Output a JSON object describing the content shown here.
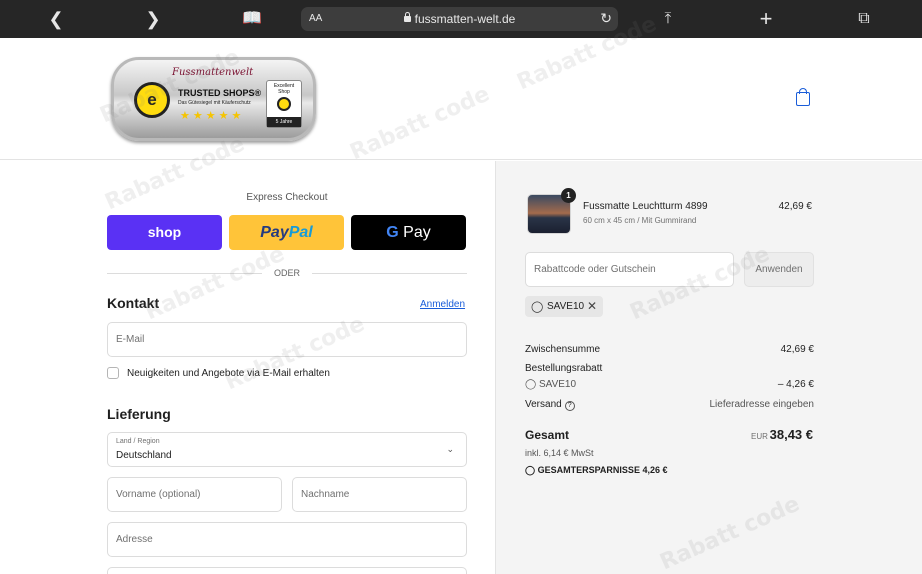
{
  "browser": {
    "text_size_label": "AA",
    "url": "fussmatten-welt.de",
    "icons": [
      "back-icon",
      "forward-icon",
      "bookmarks-icon",
      "lock-icon",
      "reload-icon",
      "share-icon",
      "new-tab-icon",
      "tabs-icon"
    ]
  },
  "header": {
    "logo_brand": "Fussmattenwelt",
    "trust_badge": {
      "title": "TRUSTED SHOPS®",
      "subtitle": "Das Gütesiegel mit Käuferschutz",
      "stars": "★★★★★",
      "box_line1": "Excellent",
      "box_line2": "Shop",
      "box_years": "5 Jahre"
    },
    "cart_icon": "shopping-bag-icon"
  },
  "checkout": {
    "express_label": "Express Checkout",
    "shop_pay_label": "shop",
    "paypal_part1": "Pay",
    "paypal_part2": "Pal",
    "gpay_g": "G",
    "gpay_label": "Pay",
    "divider": "ODER",
    "contact_title": "Kontakt",
    "login_link": "Anmelden",
    "email_placeholder": "E-Mail",
    "newsletter_label": "Neuigkeiten und Angebote via E-Mail erhalten",
    "delivery_title": "Lieferung",
    "country_label": "Land / Region",
    "country_value": "Deutschland",
    "firstname_placeholder": "Vorname (optional)",
    "lastname_placeholder": "Nachname",
    "address_placeholder": "Adresse"
  },
  "summary": {
    "item": {
      "quantity": "1",
      "name": "Fussmatte Leuchtturm 4899",
      "variant": "60 cm x 45 cm / Mit Gummirand",
      "price": "42,69 €"
    },
    "discount_placeholder": "Rabattcode oder Gutschein",
    "apply_label": "Anwenden",
    "applied_code": "SAVE10",
    "subtotal_label": "Zwischensumme",
    "subtotal_value": "42,69 €",
    "order_discount_label": "Bestellungsrabatt",
    "discount_code": "SAVE10",
    "discount_value": "– 4,26 €",
    "shipping_label": "Versand",
    "shipping_value": "Lieferadresse eingeben",
    "total_label": "Gesamt",
    "currency": "EUR",
    "total_value": "38,43 €",
    "tax_line": "inkl. 6,14 € MwSt",
    "savings_label": "GESAMTERSPARNISSE",
    "savings_value": "4,26 €"
  },
  "watermark": "Rabatt code"
}
